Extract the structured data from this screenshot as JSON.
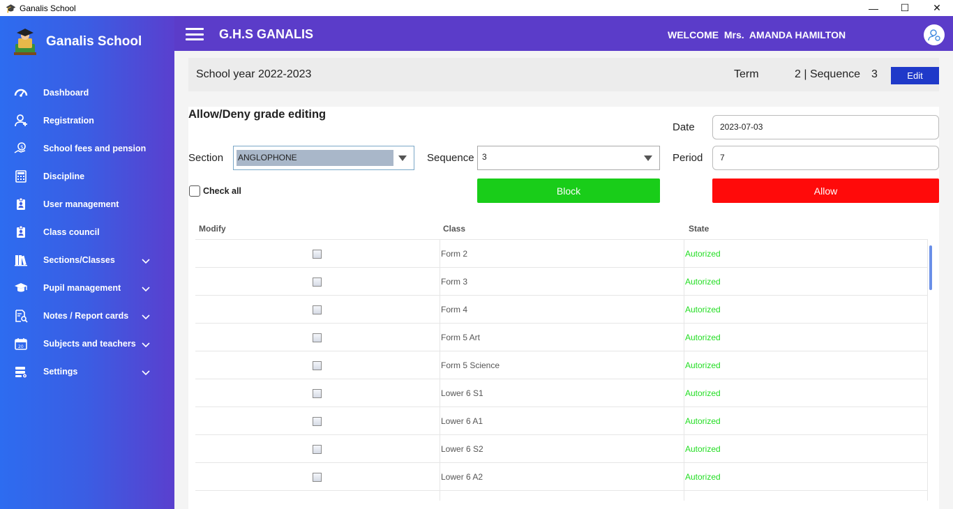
{
  "window": {
    "title": "Ganalis School",
    "controls": {
      "minimize": "—",
      "maximize": "☐",
      "close": "✕"
    }
  },
  "sidebar": {
    "brand": "Ganalis School",
    "items": [
      {
        "label": "Dashboard",
        "icon": "dashboard-icon",
        "expandable": false
      },
      {
        "label": "Registration",
        "icon": "user-plus-icon",
        "expandable": false
      },
      {
        "label": "School fees and pension",
        "icon": "money-hand-icon",
        "expandable": false
      },
      {
        "label": "Discipline",
        "icon": "calculator-icon",
        "expandable": false
      },
      {
        "label": "User management",
        "icon": "badge-icon",
        "expandable": false
      },
      {
        "label": "Class council",
        "icon": "badge-icon",
        "expandable": false
      },
      {
        "label": "Sections/Classes",
        "icon": "books-icon",
        "expandable": true
      },
      {
        "label": "Pupil management",
        "icon": "graduation-cap-icon",
        "expandable": true
      },
      {
        "label": "Notes / Report cards",
        "icon": "report-search-icon",
        "expandable": true
      },
      {
        "label": "Subjects and teachers",
        "icon": "calendar-icon",
        "expandable": true
      },
      {
        "label": "Settings",
        "icon": "settings-server-icon",
        "expandable": true
      }
    ]
  },
  "header": {
    "school": "G.H.S GANALIS",
    "welcome": "WELCOME  Mrs.  AMANDA HAMILTON"
  },
  "yearbar": {
    "school_year": "School year 2022-2023",
    "term_label": "Term",
    "term_value": "2 | Sequence",
    "sequence_value": "3",
    "edit_label": "Edit"
  },
  "form": {
    "title": "Allow/Deny grade editing",
    "section_label": "Section",
    "section_value": "ANGLOPHONE",
    "sequence_label": "Sequence",
    "sequence_value": "3",
    "date_label": "Date",
    "date_value": "2023-07-03",
    "period_label": "Period",
    "period_value": "7",
    "check_all_label": "Check all",
    "block_label": "Block",
    "allow_label": "Allow"
  },
  "table": {
    "headers": {
      "modify": "Modify",
      "class": "Class",
      "state": "State"
    },
    "rows": [
      {
        "class": "Form 2",
        "state": "Autorized"
      },
      {
        "class": "Form 3",
        "state": "Autorized"
      },
      {
        "class": "Form 4",
        "state": "Autorized"
      },
      {
        "class": "Form 5 Art",
        "state": "Autorized"
      },
      {
        "class": "Form 5 Science",
        "state": "Autorized"
      },
      {
        "class": "Lower 6 S1",
        "state": "Autorized"
      },
      {
        "class": "Lower 6 A1",
        "state": "Autorized"
      },
      {
        "class": "Lower 6 S2",
        "state": "Autorized"
      },
      {
        "class": "Lower 6 A2",
        "state": "Autorized"
      }
    ]
  },
  "colors": {
    "sidebar_start": "#2d6cf0",
    "sidebar_end": "#5a3fce",
    "topbar": "#5b3cc9",
    "edit_button": "#1f39c9",
    "block_button": "#19cd19",
    "allow_button": "#ff0a0a",
    "authorized_text": "#22dd22"
  }
}
